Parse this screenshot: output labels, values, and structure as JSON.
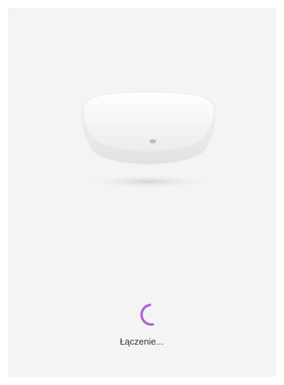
{
  "device": {
    "icon": "round-white-sensor-device",
    "color": "#ffffff"
  },
  "loading": {
    "spinner_icon": "loading-spinner-icon",
    "accent_color": "#b05fd6",
    "status_text": "Łączenie..."
  }
}
